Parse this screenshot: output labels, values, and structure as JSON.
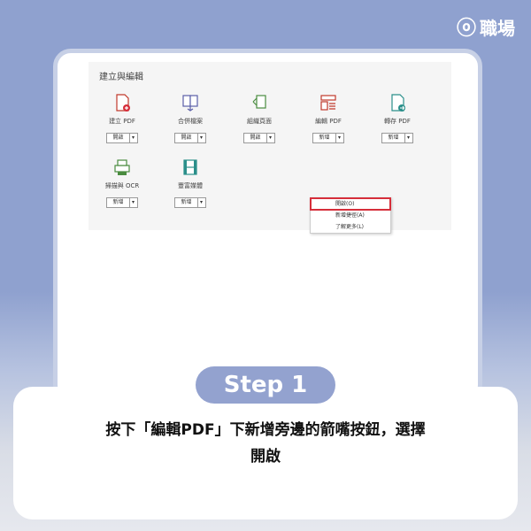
{
  "brand": {
    "logo_text": "職場"
  },
  "panel": {
    "title": "建立與編輯"
  },
  "tools": [
    {
      "label": "建立 PDF",
      "button": "開啟"
    },
    {
      "label": "合併檔案",
      "button": "開啟"
    },
    {
      "label": "組織頁面",
      "button": "開啟"
    },
    {
      "label": "編輯 PDF",
      "button": "新增"
    },
    {
      "label": "轉存 PDF",
      "button": "新增"
    },
    {
      "label": "掃描與 OCR",
      "button": "新增"
    },
    {
      "label": "豐富媒體",
      "button": "新增"
    }
  ],
  "dropdown_menu": {
    "items": [
      "開啟(O)",
      "新增捷徑(A)",
      "了解更多(L)"
    ]
  },
  "step": {
    "label": "Step 1"
  },
  "caption": {
    "line1": "按下「編輯PDF」下新增旁邊的箭嘴按鈕，選擇",
    "line2": "開啟"
  },
  "colors": {
    "accent_blue": "#93a2cf",
    "highlight_red": "#d62e3a"
  }
}
